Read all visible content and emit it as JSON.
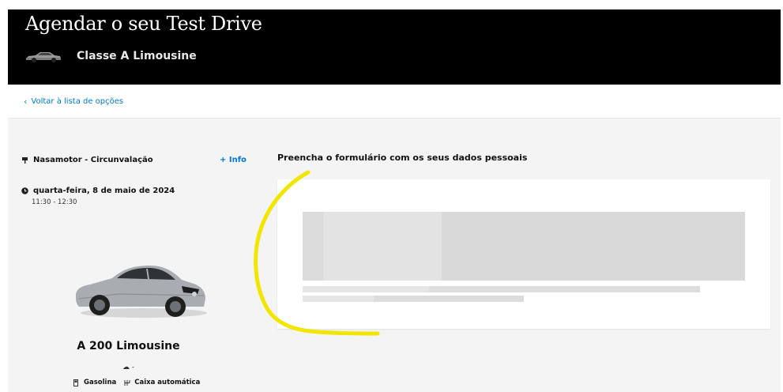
{
  "header": {
    "title": "Agendar o seu Test Drive",
    "model": "Classe A Limousine"
  },
  "nav": {
    "back_link": "Voltar à lista de opções"
  },
  "dealer": {
    "name": "Nasamotor - Circunvalação",
    "info_link": "+ Info"
  },
  "appointment": {
    "date": "quarta-feira, 8 de maio de 2024",
    "time": "11:30 - 12:30"
  },
  "vehicle": {
    "model": "A 200 Limousine",
    "engine": "-",
    "fuel": "Gasolina",
    "transmission": "Caixa automática"
  },
  "form": {
    "title": "Preencha o formulário com os seus dados pessoais"
  },
  "colors": {
    "accent": "#0078d6",
    "header_bg": "#000000",
    "annotation": "#f2e600"
  }
}
